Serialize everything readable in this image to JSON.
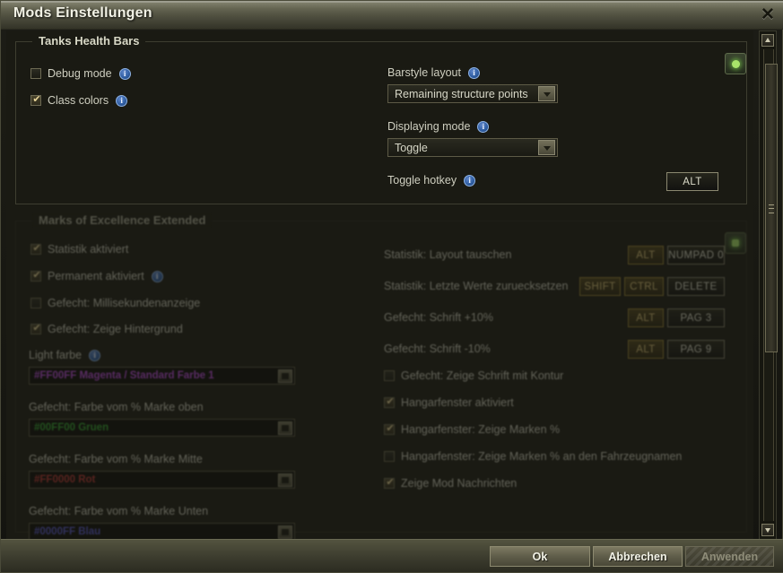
{
  "window": {
    "title": "Mods Einstellungen",
    "close_icon": "close-icon"
  },
  "sections": [
    {
      "id": "tanks-health-bars",
      "title": "Tanks Health Bars",
      "enabled": true,
      "checkboxes": [
        {
          "label": "Debug mode",
          "checked": false,
          "info": true
        },
        {
          "label": "Class colors",
          "checked": true,
          "info": true
        }
      ],
      "fields": [
        {
          "label": "Barstyle layout",
          "info": true,
          "type": "dropdown",
          "value": "Remaining structure points"
        },
        {
          "label": "Displaying mode",
          "info": true,
          "type": "dropdown",
          "value": "Toggle"
        },
        {
          "label": "Toggle hotkey",
          "info": true,
          "type": "hotkey",
          "keys": [
            "ALT"
          ]
        }
      ],
      "reset_button": "reset-icon-button"
    },
    {
      "id": "marks-of-excellence-extended",
      "title": "Marks of Excellence Extended",
      "enabled": false,
      "checkboxes_left": [
        {
          "label": "Statistik aktiviert",
          "checked": true,
          "info": false
        },
        {
          "label": "Permanent aktiviert",
          "checked": true,
          "info": true
        },
        {
          "label": "Gefecht: Millisekundenanzeige",
          "checked": false,
          "info": false
        },
        {
          "label": "Gefecht: Zeige Hintergrund",
          "checked": true,
          "info": false
        }
      ],
      "text_fields": [
        {
          "label": "Light farbe",
          "info": true,
          "value": "#FF00FF Magenta / Standard Farbe 1",
          "color": "#b244d6"
        },
        {
          "label": "Gefecht: Farbe vom % Marke oben",
          "info": false,
          "value": "#00FF00 Gruen",
          "color": "#2e9e2e"
        },
        {
          "label": "Gefecht: Farbe vom % Marke Mitte",
          "info": false,
          "value": "#FF0000 Rot",
          "color": "#b33030"
        },
        {
          "label": "Gefecht: Farbe vom % Marke Unten",
          "info": false,
          "value": "#0000FF Blau",
          "color": "#5252c8"
        }
      ],
      "hotkey_rows": [
        {
          "label": "Statistik: Layout tauschen",
          "keys": [
            {
              "text": "ALT",
              "style": "mod"
            },
            {
              "text": "NUMPAD 0",
              "style": "dark"
            }
          ]
        },
        {
          "label": "Statistik: Letzte Werte zuruecksetzen",
          "keys": [
            {
              "text": "SHIFT",
              "style": "mod"
            },
            {
              "text": "CTRL",
              "style": "mod"
            },
            {
              "text": "DELETE",
              "style": "dark"
            }
          ]
        },
        {
          "label": "Gefecht: Schrift +10%",
          "keys": [
            {
              "text": "ALT",
              "style": "mod"
            },
            {
              "text": "PAG 3",
              "style": "dark"
            }
          ]
        },
        {
          "label": "Gefecht: Schrift -10%",
          "keys": [
            {
              "text": "ALT",
              "style": "mod"
            },
            {
              "text": "PAG 9",
              "style": "dark"
            }
          ]
        }
      ],
      "checkboxes_right": [
        {
          "label": "Gefecht: Zeige Schrift mit Kontur",
          "checked": false
        },
        {
          "label": "Hangarfenster aktiviert",
          "checked": true
        },
        {
          "label": "Hangarfenster: Zeige Marken %",
          "checked": true
        },
        {
          "label": "Hangarfenster: Zeige Marken % an den Fahrzeugnamen",
          "checked": false
        },
        {
          "label": "Zeige Mod Nachrichten",
          "checked": true
        }
      ],
      "reset_button": "reset-icon-button"
    }
  ],
  "scrollbar": {
    "up_icon": "chevron-up-icon",
    "down_icon": "chevron-down-icon",
    "grip_icon": "grip-icon"
  },
  "footer": {
    "ok_label": "Ok",
    "cancel_label": "Abbrechen",
    "apply_label": "Anwenden",
    "apply_disabled": true
  },
  "colors": {
    "titlebar": "#59594 7",
    "accent_green": "#a8e36a",
    "modifier_key": "#d9c27a",
    "info_blue": "#2f5ea3"
  }
}
